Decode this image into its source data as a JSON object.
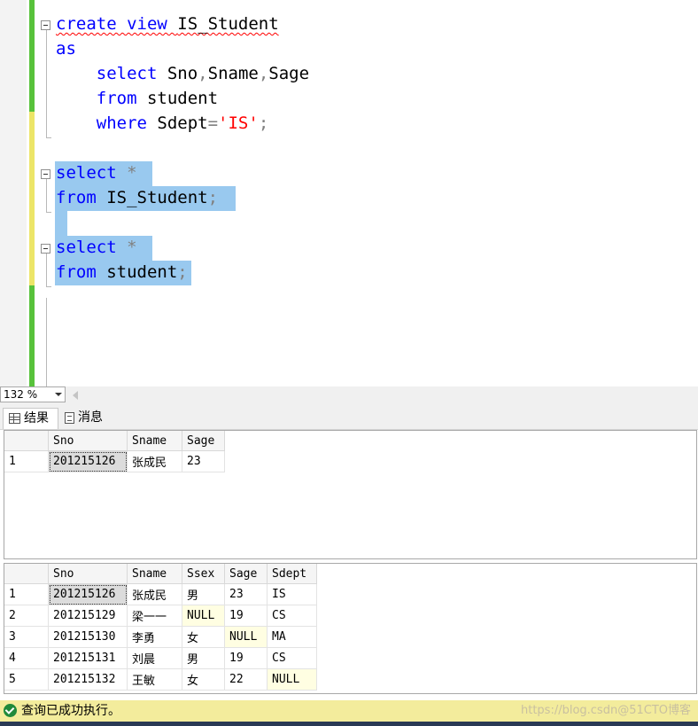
{
  "editor": {
    "lines": [
      {
        "parts": [
          {
            "t": "create view ",
            "c": "kw"
          },
          {
            "t": "IS_Student",
            "c": ""
          }
        ]
      },
      {
        "parts": [
          {
            "t": "as",
            "c": "kw"
          }
        ]
      },
      {
        "parts": [
          {
            "t": "    select ",
            "c": "kw"
          },
          {
            "t": "Sno",
            "c": ""
          },
          {
            "t": ",",
            "c": "gry"
          },
          {
            "t": "Sname",
            "c": ""
          },
          {
            "t": ",",
            "c": "gry"
          },
          {
            "t": "Sage",
            "c": ""
          }
        ]
      },
      {
        "parts": [
          {
            "t": "    from ",
            "c": "kw"
          },
          {
            "t": "student",
            "c": ""
          }
        ]
      },
      {
        "parts": [
          {
            "t": "    where ",
            "c": "kw"
          },
          {
            "t": "Sdept",
            "c": ""
          },
          {
            "t": "=",
            "c": "gry"
          },
          {
            "t": "'IS'",
            "c": "str"
          },
          {
            "t": ";",
            "c": "gry"
          }
        ]
      },
      {
        "parts": []
      },
      {
        "parts": [
          {
            "t": "select ",
            "c": "kw"
          },
          {
            "t": "*",
            "c": "gry"
          }
        ]
      },
      {
        "parts": [
          {
            "t": "from ",
            "c": "kw"
          },
          {
            "t": "IS_Student",
            "c": ""
          },
          {
            "t": ";",
            "c": "gry"
          }
        ]
      },
      {
        "parts": []
      },
      {
        "parts": [
          {
            "t": "select ",
            "c": "kw"
          },
          {
            "t": "*",
            "c": "gry"
          }
        ]
      },
      {
        "parts": [
          {
            "t": "from ",
            "c": "kw"
          },
          {
            "t": "student",
            "c": ""
          },
          {
            "t": ";",
            "c": "gry"
          }
        ]
      }
    ]
  },
  "zoom": {
    "value": "132 %"
  },
  "tabs": {
    "results": "结果",
    "messages": "消息"
  },
  "result1": {
    "columns": [
      "",
      "Sno",
      "Sname",
      "Sage"
    ],
    "rows": [
      [
        "1",
        "201215126",
        "张成民",
        "23"
      ]
    ]
  },
  "result2": {
    "columns": [
      "",
      "Sno",
      "Sname",
      "Ssex",
      "Sage",
      "Sdept"
    ],
    "rows": [
      [
        "1",
        "201215126",
        "张成民",
        "男",
        "23",
        "IS"
      ],
      [
        "2",
        "201215129",
        "梁一一",
        "NULL",
        "19",
        "CS"
      ],
      [
        "3",
        "201215130",
        "李勇",
        "女",
        "NULL",
        "MA"
      ],
      [
        "4",
        "201215131",
        "刘晨",
        "男",
        "19",
        "CS"
      ],
      [
        "5",
        "201215132",
        "王敏",
        "女",
        "22",
        "NULL"
      ]
    ]
  },
  "status": {
    "text": "查询已成功执行。",
    "watermark": "https://blog.csdn@51CTO博客"
  },
  "colors": {
    "keyword": "#0000ff",
    "string": "#ff0000",
    "selection": "#99c9ef",
    "status_bg": "#f3ec9c"
  }
}
